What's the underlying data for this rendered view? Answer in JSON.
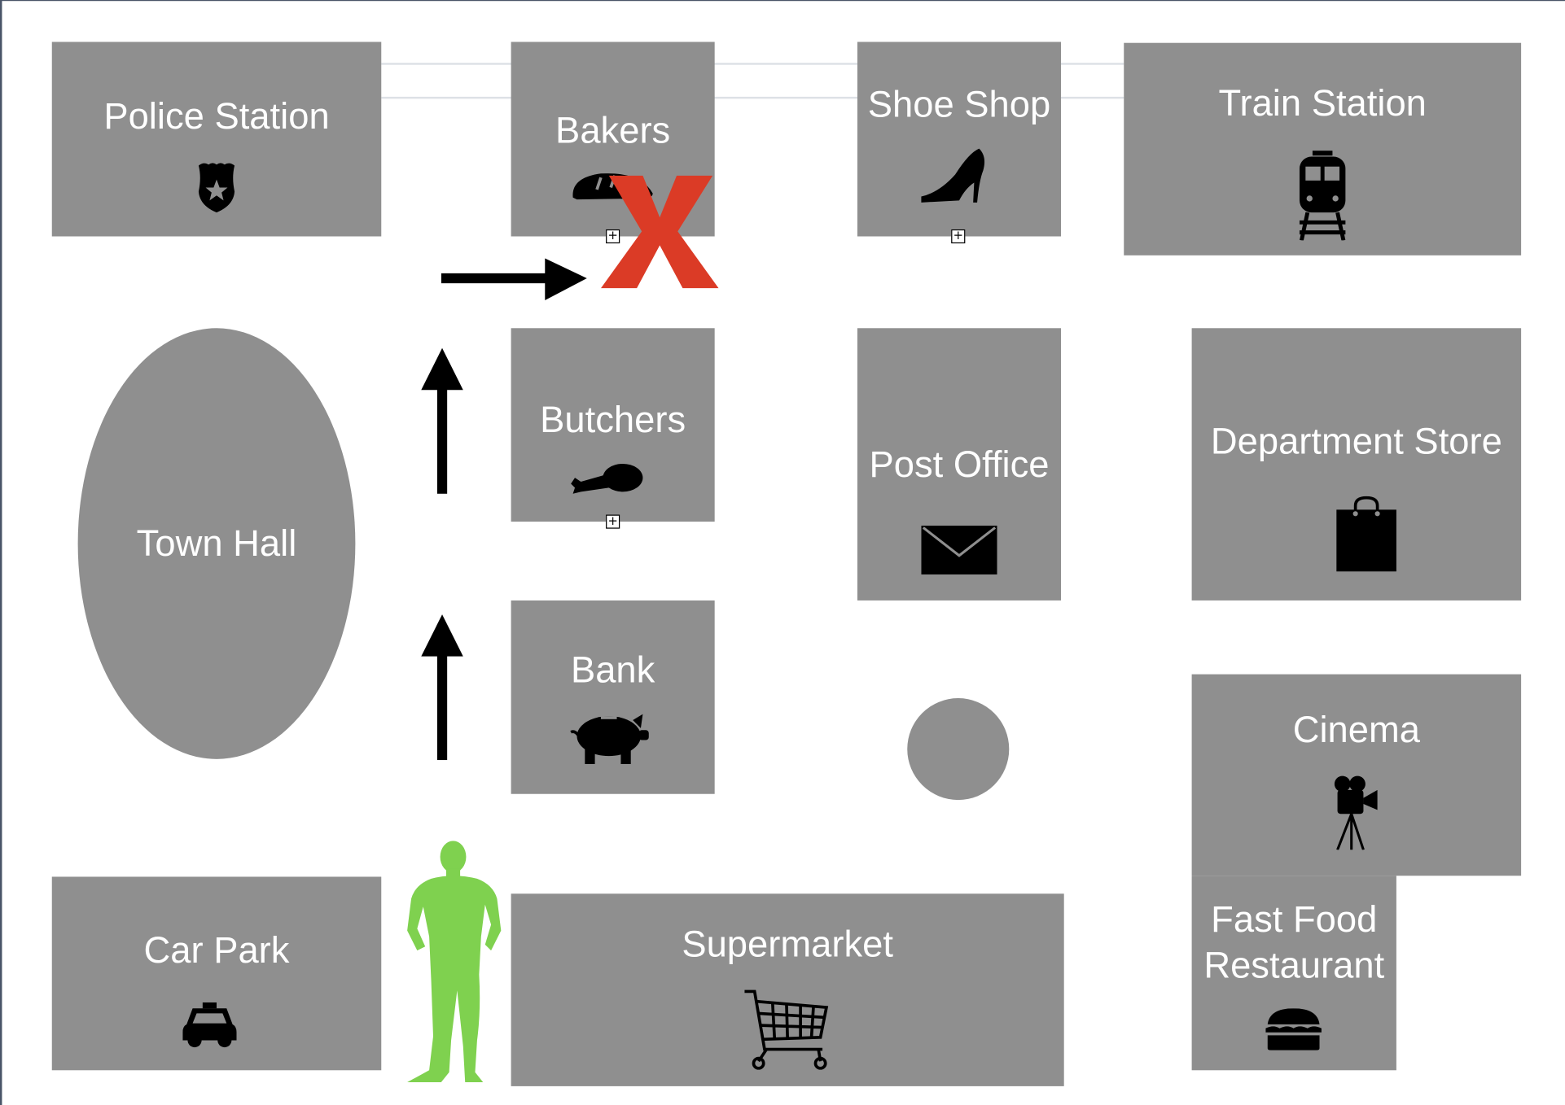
{
  "locations": {
    "police_station": "Police Station",
    "bakers": "Bakers",
    "shoe_shop": "Shoe Shop",
    "train_station": "Train Station",
    "town_hall": "Town Hall",
    "butchers": "Butchers",
    "post_office": "Post Office",
    "department_store": "Department Store",
    "bank": "Bank",
    "cinema": "Cinema",
    "fast_food": "Fast Food Restaurant",
    "car_park": "Car Park",
    "supermarket": "Supermarket"
  },
  "colors": {
    "building": "#8f8f8f",
    "cross": "#db3b26",
    "person": "#7fd14f",
    "arrow": "#000000"
  }
}
